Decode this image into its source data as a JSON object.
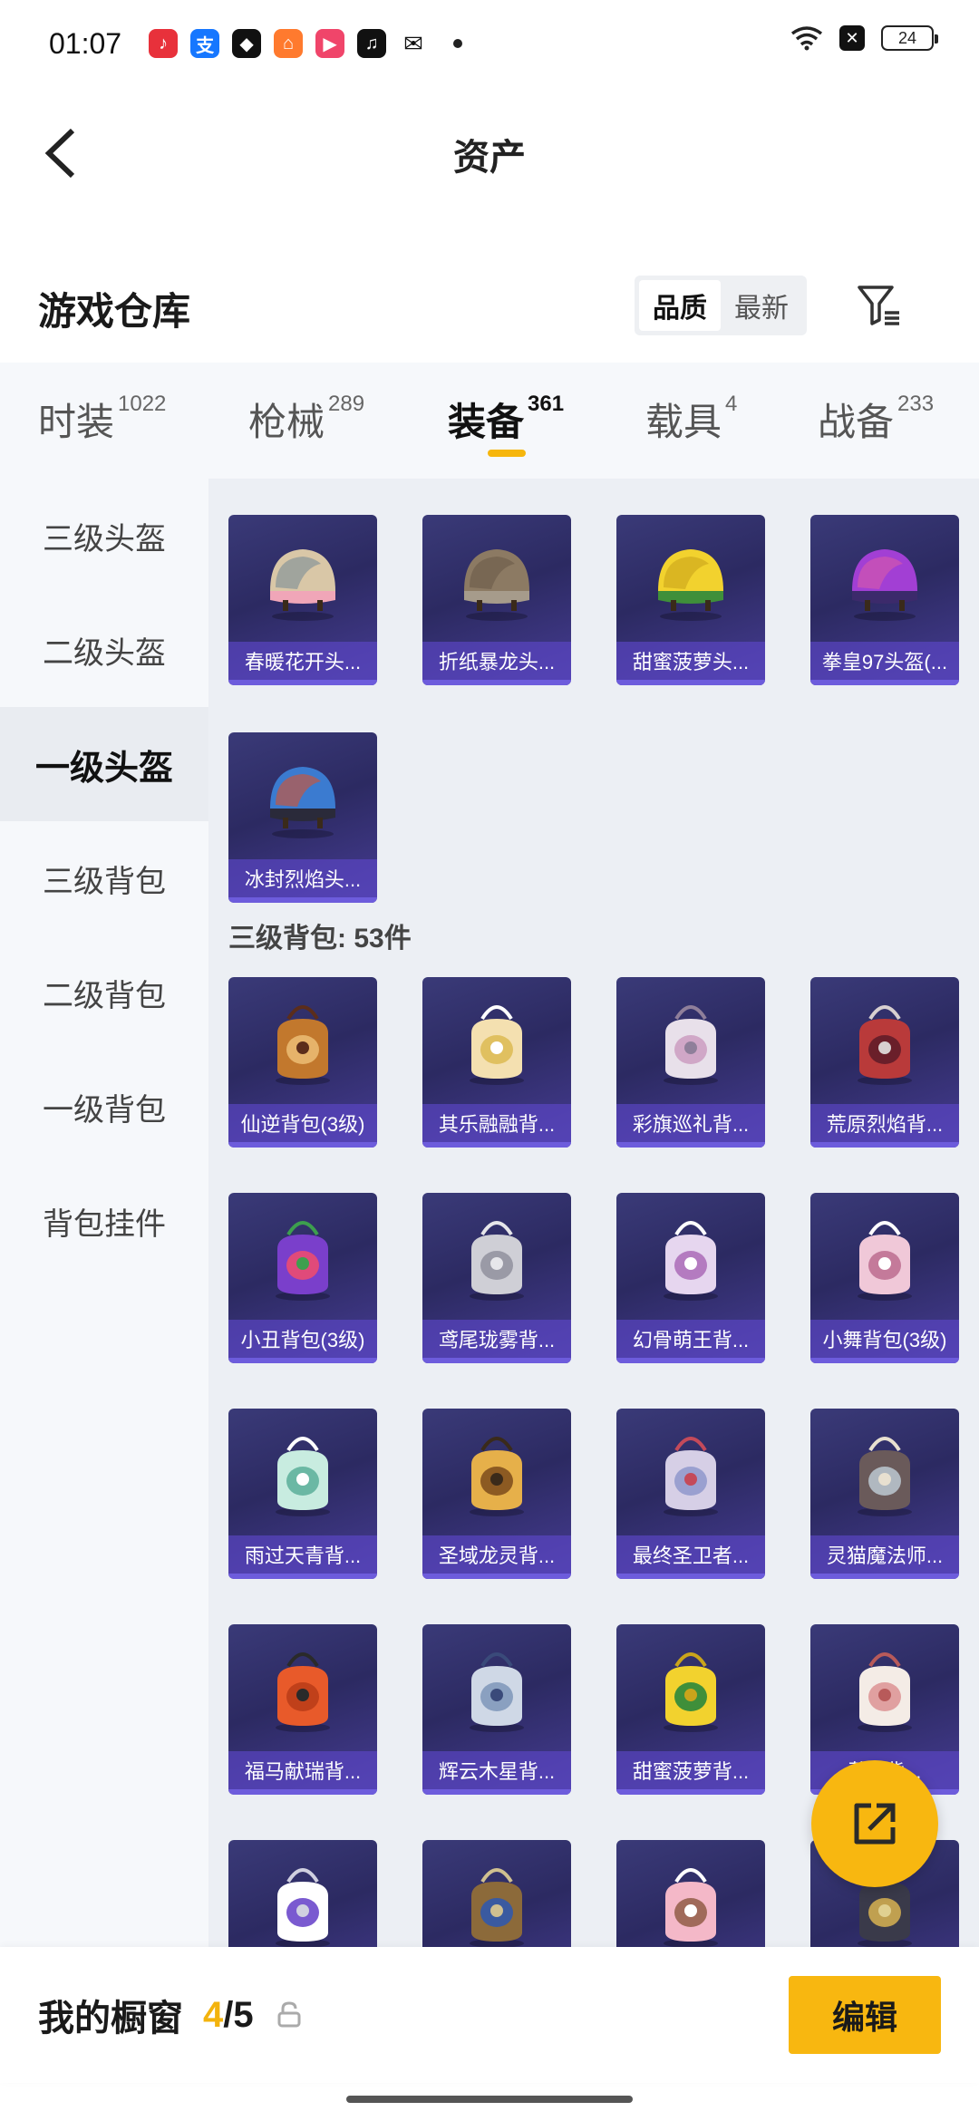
{
  "status_bar": {
    "time": "01:07",
    "battery": "24"
  },
  "header": {
    "title": "资产"
  },
  "warehouse": {
    "title": "游戏仓库",
    "sort_options": [
      "品质",
      "最新"
    ],
    "active_sort": "品质"
  },
  "tabs": [
    {
      "label": "时装",
      "count": "1022"
    },
    {
      "label": "枪械",
      "count": "289"
    },
    {
      "label": "装备",
      "count": "361",
      "active": true
    },
    {
      "label": "载具",
      "count": "4"
    },
    {
      "label": "战备",
      "count": "233"
    }
  ],
  "sidebar": {
    "items": [
      {
        "label": "三级头盔"
      },
      {
        "label": "二级头盔"
      },
      {
        "label": "一级头盔",
        "active": true
      },
      {
        "label": "三级背包"
      },
      {
        "label": "二级背包"
      },
      {
        "label": "一级背包"
      },
      {
        "label": "背包挂件"
      }
    ]
  },
  "helmet_items": [
    {
      "label": "春暖花开头...",
      "icon": "helmet-floral-icon"
    },
    {
      "label": "折纸暴龙头...",
      "icon": "helmet-dino-icon"
    },
    {
      "label": "甜蜜菠萝头...",
      "icon": "helmet-pineapple-icon"
    },
    {
      "label": "拳皇97头盔(...",
      "icon": "helmet-kof-icon"
    },
    {
      "label": "冰封烈焰头...",
      "icon": "helmet-ice-flame-icon"
    }
  ],
  "backpack_section": {
    "title": "三级背包: 53件"
  },
  "backpack_items": [
    {
      "label": "仙逆背包(3级)",
      "icon": "backpack-xianni-icon"
    },
    {
      "label": "其乐融融背...",
      "icon": "backpack-cake-icon"
    },
    {
      "label": "彩旗巡礼背...",
      "icon": "backpack-flag-icon"
    },
    {
      "label": "荒原烈焰背...",
      "icon": "backpack-flame-icon"
    },
    {
      "label": "小丑背包(3级)",
      "icon": "backpack-clown-icon"
    },
    {
      "label": "鸢尾珑雾背...",
      "icon": "backpack-iris-icon"
    },
    {
      "label": "幻骨萌王背...",
      "icon": "backpack-bone-icon"
    },
    {
      "label": "小舞背包(3级)",
      "icon": "backpack-xiaowu-icon"
    },
    {
      "label": "雨过天青背...",
      "icon": "backpack-celadon-icon"
    },
    {
      "label": "圣域龙灵背...",
      "icon": "backpack-dragon-icon"
    },
    {
      "label": "最终圣卫者...",
      "icon": "backpack-guardian-icon"
    },
    {
      "label": "灵猫魔法师...",
      "icon": "backpack-cat-icon"
    },
    {
      "label": "福马献瑞背...",
      "icon": "backpack-horse-icon"
    },
    {
      "label": "辉云木星背...",
      "icon": "backpack-jupiter-icon"
    },
    {
      "label": "甜蜜菠萝背...",
      "icon": "backpack-pineapple-icon"
    },
    {
      "label": "莉...背...",
      "icon": "backpack-doll-icon"
    },
    {
      "label": "",
      "icon": "backpack-snowman-icon"
    },
    {
      "label": "",
      "icon": "backpack-frame-icon"
    },
    {
      "label": "",
      "icon": "backpack-drink-icon"
    },
    {
      "label": "",
      "icon": "backpack-gold-icon"
    }
  ],
  "bottom_bar": {
    "label": "我的橱窗",
    "current": "4",
    "separator_total": "/5",
    "edit_label": "编辑"
  },
  "colors": {
    "accent": "#f8b710",
    "card_bg": "#2c2a62",
    "card_label": "#5c46c8"
  }
}
